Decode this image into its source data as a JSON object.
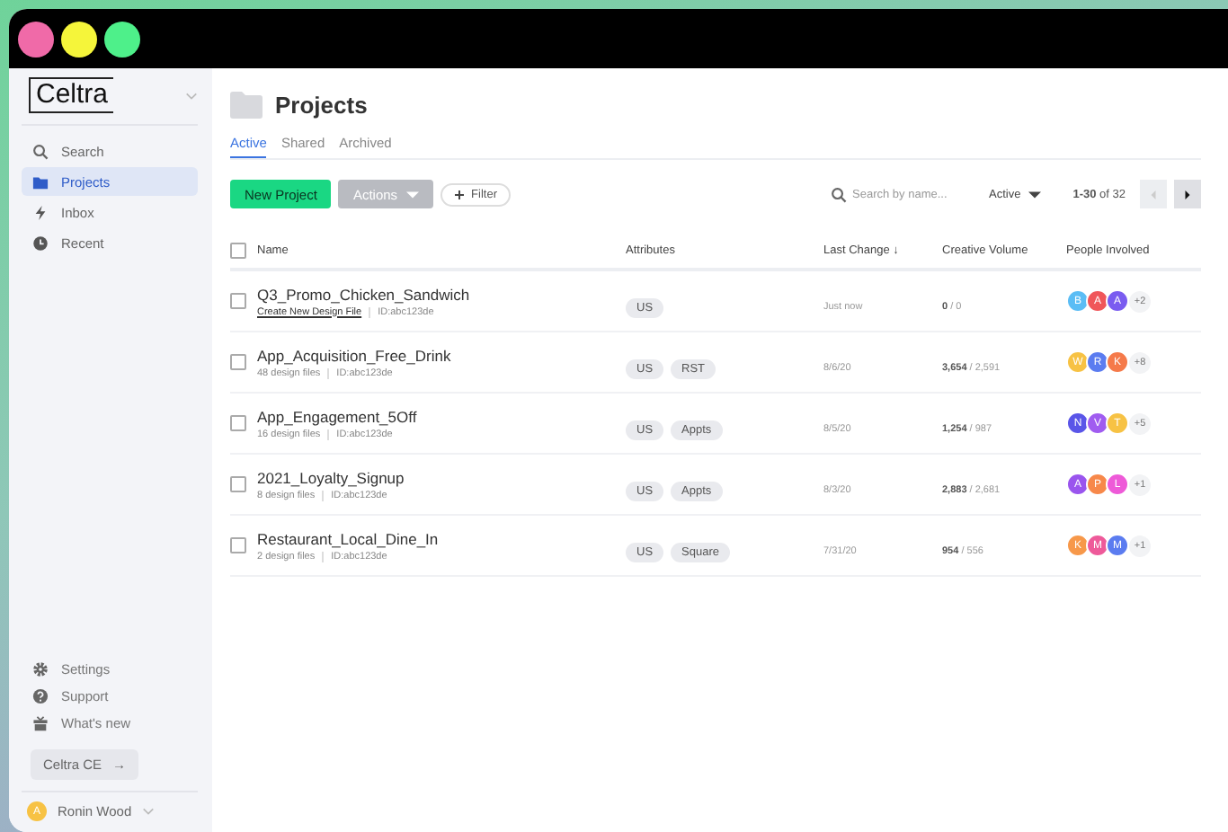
{
  "window": {
    "controls": [
      {
        "color": "#f06aa8"
      },
      {
        "color": "#f5f53a"
      },
      {
        "color": "#4ef08a"
      }
    ]
  },
  "sidebar": {
    "logo": "Celtra",
    "items": [
      {
        "kind": "search",
        "label": "Search",
        "selected": false
      },
      {
        "kind": "folder",
        "label": "Projects",
        "selected": true
      },
      {
        "kind": "bolt",
        "label": "Inbox",
        "selected": false
      },
      {
        "kind": "clock",
        "label": "Recent",
        "selected": false
      }
    ],
    "footer_items": [
      {
        "kind": "gear",
        "label": "Settings"
      },
      {
        "kind": "help",
        "label": "Support"
      },
      {
        "kind": "gift",
        "label": "What's new"
      }
    ],
    "ce_button": {
      "label": "Celtra CE",
      "arrow": "→"
    },
    "user": {
      "initial": "A",
      "name": "Ronin Wood"
    }
  },
  "page": {
    "title": "Projects",
    "tabs": [
      {
        "label": "Active",
        "selected": true
      },
      {
        "label": "Shared",
        "selected": false
      },
      {
        "label": "Archived",
        "selected": false
      }
    ]
  },
  "toolbar": {
    "new_button": "New Project",
    "actions_button": {
      "label": "Actions",
      "disabled": true
    },
    "filter_button": "Filter",
    "search": {
      "placeholder": "Search by name..."
    },
    "status_dropdown": "Active",
    "range": "**1-30** of 32"
  },
  "table": {
    "columns": [
      {
        "label": "Name"
      },
      {
        "label": "Attributes"
      },
      {
        "label": "Last Change",
        "sort_indicator": "↓"
      },
      {
        "label": "Creative Volume"
      },
      {
        "label": "People Involved"
      }
    ],
    "header_checked": false,
    "rows": [
      {
        "checked": false,
        "name": "Q3_Promo_Chicken_Sandwich",
        "files": "Create New Design File",
        "files_link": true,
        "id": "ID:abc123de",
        "tags": [
          "US"
        ],
        "last_change": "Just now",
        "volume": "**0** / 0",
        "people": [
          {
            "initial": "B",
            "color": "#5bbdf5"
          },
          {
            "initial": "A",
            "color": "#f0565a"
          },
          {
            "initial": "A",
            "color": "#7a5cf0"
          }
        ],
        "extra": "+2"
      },
      {
        "checked": false,
        "name": "App_Acquisition_Free_Drink",
        "files": "48 design files",
        "files_link": false,
        "id": "ID:abc123de",
        "tags": [
          "US",
          "RST"
        ],
        "last_change": "8/6/20",
        "volume": "**3,654** / 2,591",
        "people": [
          {
            "initial": "W",
            "color": "#f7c244"
          },
          {
            "initial": "R",
            "color": "#5b7cf0"
          },
          {
            "initial": "K",
            "color": "#f57a4a"
          }
        ],
        "extra": "+8"
      },
      {
        "checked": false,
        "name": "App_Engagement_5Off",
        "files": "16 design files",
        "files_link": false,
        "id": "ID:abc123de",
        "tags": [
          "US",
          "Appts"
        ],
        "last_change": "8/5/20",
        "volume": "**1,254** / 987",
        "people": [
          {
            "initial": "N",
            "color": "#5a55e8"
          },
          {
            "initial": "V",
            "color": "#a05cf0"
          },
          {
            "initial": "T",
            "color": "#f7c244"
          }
        ],
        "extra": "+5"
      },
      {
        "checked": false,
        "name": "2021_Loyalty_Signup",
        "files": "8 design files",
        "files_link": false,
        "id": "ID:abc123de",
        "tags": [
          "US",
          "Appts"
        ],
        "last_change": "8/3/20",
        "volume": "**2,883** / 2,681",
        "people": [
          {
            "initial": "A",
            "color": "#9a55ee"
          },
          {
            "initial": "P",
            "color": "#f7884a"
          },
          {
            "initial": "L",
            "color": "#ee5ad8"
          }
        ],
        "extra": "+1"
      },
      {
        "checked": false,
        "name": "Restaurant_Local_Dine_In",
        "files": "2 design files",
        "files_link": false,
        "id": "ID:abc123de",
        "tags": [
          "US",
          "Square"
        ],
        "last_change": "7/31/20",
        "volume": "**954** / 556",
        "people": [
          {
            "initial": "K",
            "color": "#f7984a"
          },
          {
            "initial": "M",
            "color": "#ee5a9a"
          },
          {
            "initial": "M",
            "color": "#5b7cf0"
          }
        ],
        "extra": "+1"
      }
    ]
  }
}
